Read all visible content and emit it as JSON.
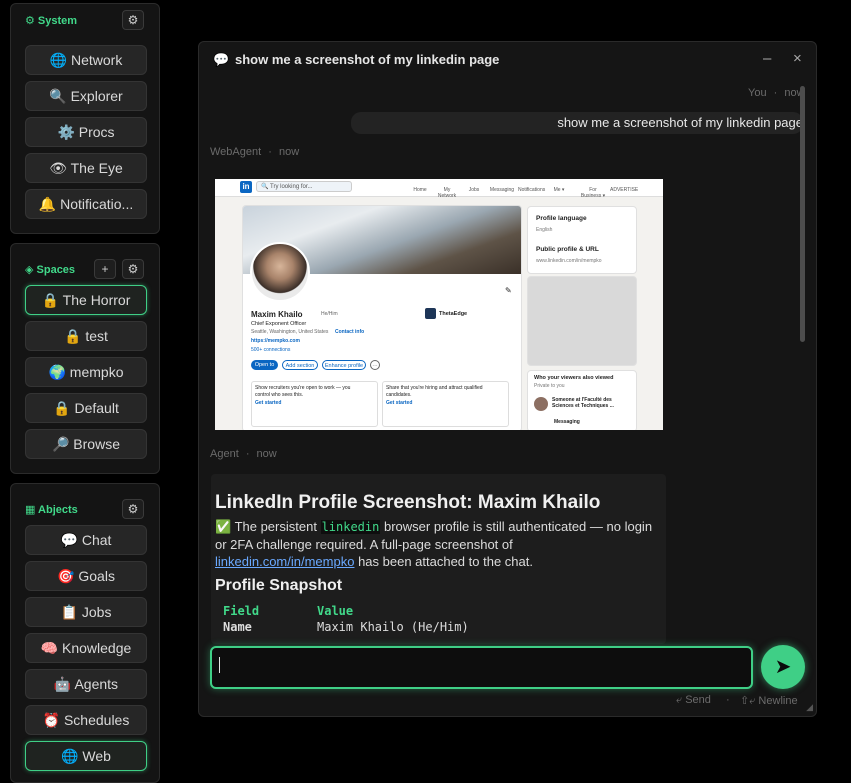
{
  "system": {
    "title": "⚙ System",
    "gear": "⚙",
    "items": [
      {
        "label": "🌐 Network"
      },
      {
        "label": "🔍 Explorer"
      },
      {
        "label": "⚙️ Procs"
      },
      {
        "label": "👁 The Eye"
      },
      {
        "label": "🔔 Notificatio..."
      }
    ]
  },
  "spaces": {
    "title": "◈ Spaces",
    "add": "+",
    "gear": "⚙",
    "items": [
      {
        "label": "🔒 The Horror"
      },
      {
        "label": "🔒 test"
      },
      {
        "label": "🌍 mempko"
      },
      {
        "label": "🔒 Default"
      },
      {
        "label": "🔎 Browse"
      }
    ]
  },
  "abjects": {
    "title": "▦ Abjects",
    "gear": "⚙",
    "items": [
      {
        "label": "💬 Chat"
      },
      {
        "label": "🎯 Goals"
      },
      {
        "label": "📋 Jobs"
      },
      {
        "label": "🧠 Knowledge"
      },
      {
        "label": "🤖 Agents"
      },
      {
        "label": "⏰ Schedules"
      },
      {
        "label": "🌐 Web"
      }
    ]
  },
  "chat": {
    "icon": "💬",
    "title": "show me a screenshot of my linkedin page",
    "minimize": "–",
    "close": "×",
    "user_meta": {
      "who": "You",
      "sep": "·",
      "when": "now"
    },
    "user_message": "show me a screenshot of my linkedin page",
    "webagent_meta": {
      "who": "WebAgent",
      "sep": "·",
      "when": "now"
    },
    "agent_meta": {
      "who": "Agent",
      "sep": "·",
      "when": "now"
    },
    "agent": {
      "heading": "LinkedIn Profile Screenshot: Maxim Khailo",
      "p1_a": "✅ The persistent ",
      "p1_code": "linkedin",
      "p1_b": " browser profile is still authenticated — no login or 2FA challenge required. A full-page screenshot of ",
      "p1_link": "linkedin.com/in/mempko",
      "p1_c": " has been attached to the chat.",
      "subheading": "Profile Snapshot",
      "table_header": [
        "Field",
        "Value"
      ],
      "table_rows": [
        [
          "Name",
          "Maxim Khailo (He/Him)"
        ]
      ]
    },
    "composer": {
      "value": ""
    },
    "send_icon": "➤",
    "hint_send": "⤶ Send",
    "hint_sep": "·",
    "hint_newline": "⇧⤶ Newline"
  },
  "screenshot": {
    "logo": "in",
    "search": "🔍 Try looking for...",
    "nav": [
      "Home",
      "My Network",
      "Jobs",
      "Messaging",
      "Notifications",
      "Me ▾",
      "For Business ▾",
      "ADVERTISE"
    ],
    "name": "Maxim Khailo",
    "pronoun": "He/Him",
    "headline": "Chief Exponent Officer",
    "location": "Seattle, Washington, United States",
    "contact": "Contact info",
    "site": "https://mempko.com",
    "connections": "500+ connections",
    "company": "ThetaEdge",
    "btn_open": "Open to",
    "btn_add": "Add section",
    "btn_enhance": "Enhance profile",
    "btn_more": "···",
    "card1": "Show recruiters you're open to work — you control who sees this.",
    "card1_link": "Get started",
    "card2": "Share that you're hiring and attract qualified candidates.",
    "card2_link": "Get started",
    "side_lang": "Profile language",
    "side_lang_val": "English",
    "side_url": "Public profile & URL",
    "side_url_val": "www.linkedin.com/in/mempko",
    "viewers": "Who your viewers also viewed",
    "viewers_sub": "Private to you",
    "viewer_text": "Someone at l'Faculté des Sciences et Techniques ...",
    "messaging": "Messaging"
  }
}
